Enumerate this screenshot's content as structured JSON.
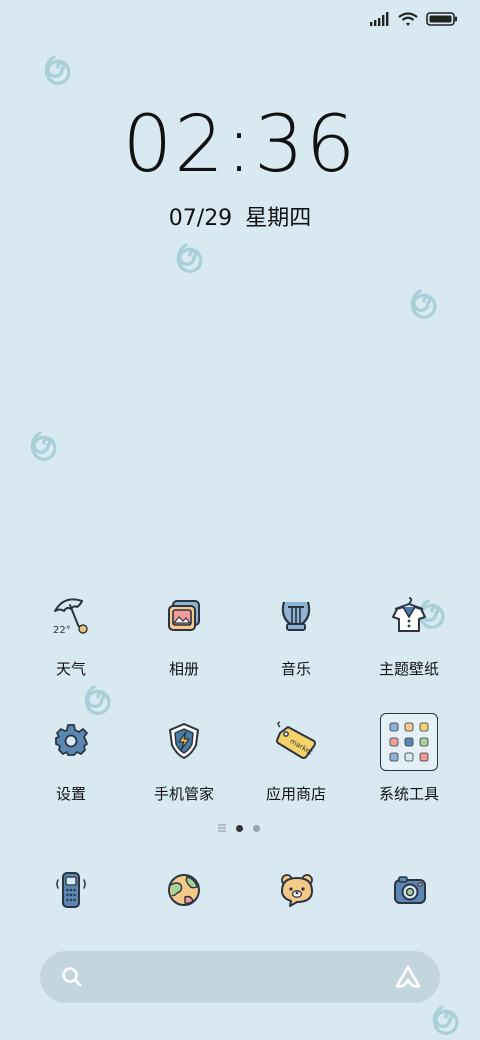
{
  "status_bar": {
    "signal_icon": "signal-icon",
    "wifi_icon": "wifi-icon",
    "battery_icon": "battery-icon"
  },
  "lock": {
    "time": "02:36",
    "date": "07/29",
    "weekday": "星期四"
  },
  "apps": [
    {
      "label": "天气",
      "icon": "weather-umbrella-icon",
      "temp": "22°"
    },
    {
      "label": "相册",
      "icon": "gallery-icon"
    },
    {
      "label": "音乐",
      "icon": "music-lyre-icon"
    },
    {
      "label": "主题壁纸",
      "icon": "theme-shirt-icon"
    },
    {
      "label": "设置",
      "icon": "settings-gear-icon"
    },
    {
      "label": "手机管家",
      "icon": "security-shield-icon"
    },
    {
      "label": "应用商店",
      "icon": "app-store-tag-icon",
      "tag": "market"
    },
    {
      "label": "系统工具",
      "icon": "system-tools-folder-icon"
    }
  ],
  "page_indicator": {
    "pages": 2,
    "current": 1
  },
  "dock": [
    {
      "icon": "phone-icon"
    },
    {
      "icon": "browser-globe-icon"
    },
    {
      "icon": "messages-bear-icon"
    },
    {
      "icon": "camera-icon"
    }
  ],
  "search_bar": {
    "search_icon": "search-icon",
    "assistant_icon": "assistant-icon"
  },
  "colors": {
    "background": "#d8e9f1",
    "swirl": "#a9cfd8",
    "search_bg": "#c3d5de"
  }
}
